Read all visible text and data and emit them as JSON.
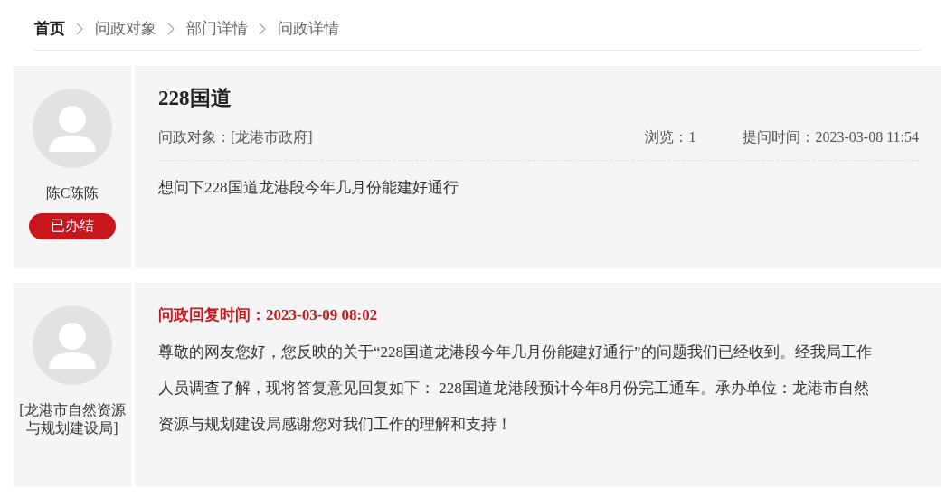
{
  "breadcrumb": [
    {
      "label": "首页",
      "current": true
    },
    {
      "label": "问政对象",
      "current": false
    },
    {
      "label": "部门详情",
      "current": false
    },
    {
      "label": "问政详情",
      "current": false
    }
  ],
  "question": {
    "user": "陈C陈陈",
    "status": "已办结",
    "title": "228国道",
    "target_label": "问政对象：",
    "target": "[龙港市政府]",
    "views": "浏览：1",
    "time": "提问时间：2023-03-08 11:54",
    "content": "想问下228国道龙港段今年几月份能建好通行"
  },
  "reply": {
    "user": "[龙港市自然资源与规划建设局]",
    "time": "问政回复时间：2023-03-09 08:02",
    "content": "尊敬的网友您好，您反映的关于“228国道龙港段今年几月份能建好通行”的问题我们已经收到。经我局工作人员调查了解，现将答复意见回复如下： 228国道龙港段预计今年8月份完工通车。承办单位：龙港市自然资源与规划建设局感谢您对我们工作的理解和支持！"
  }
}
